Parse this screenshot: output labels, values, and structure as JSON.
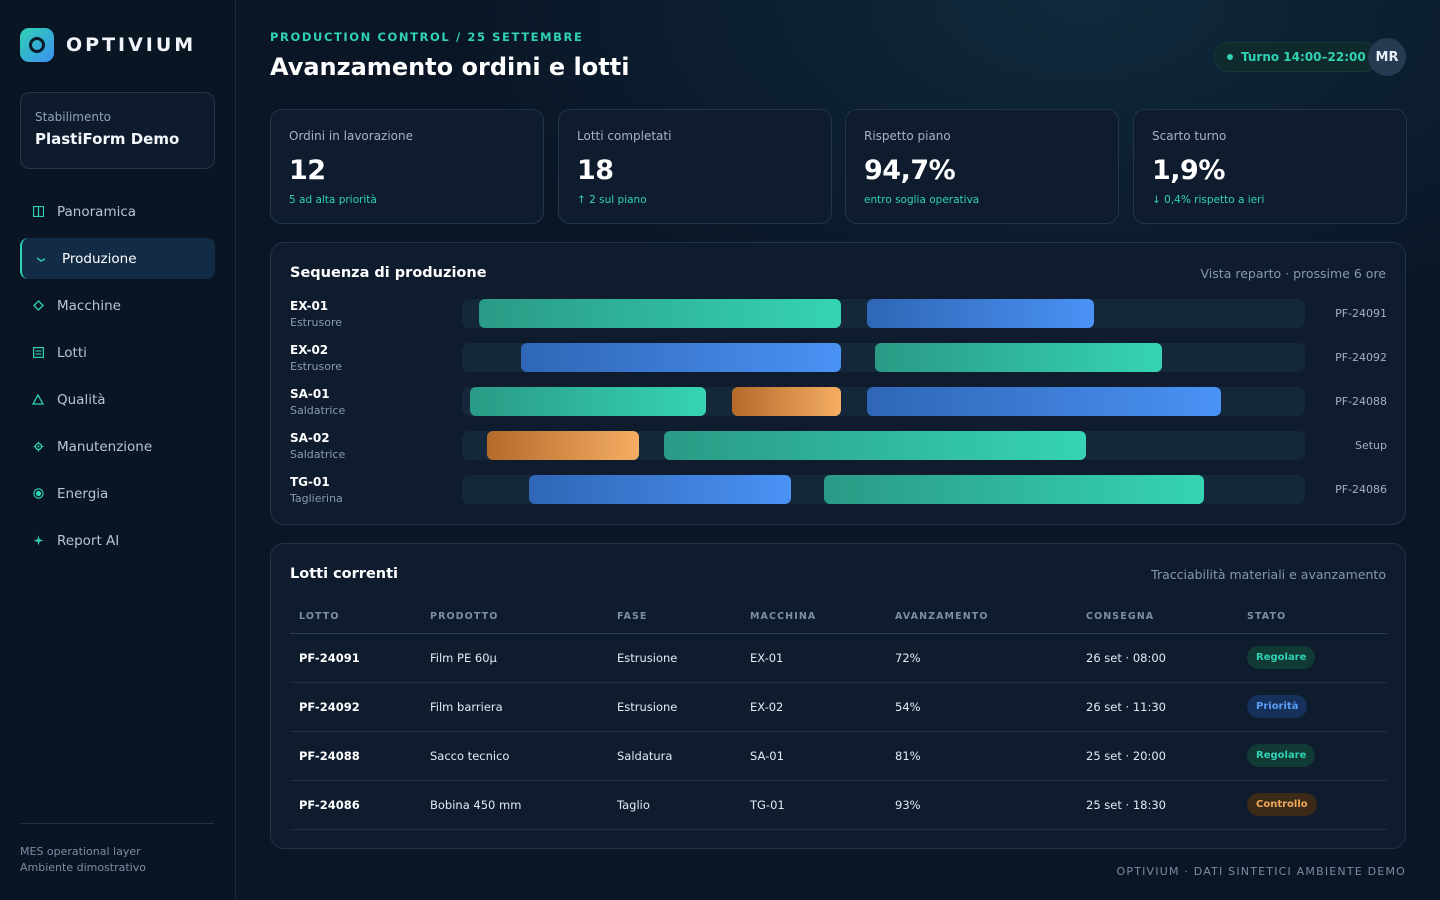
{
  "brand": {
    "name": "OPTIVIUM"
  },
  "plant": {
    "label": "Stabilimento",
    "name": "PlastiForm Demo"
  },
  "nav": [
    {
      "label": "Panoramica",
      "icon": "layout-icon",
      "active": false
    },
    {
      "label": "Produzione",
      "icon": "trend-icon",
      "active": true
    },
    {
      "label": "Macchine",
      "icon": "diamond-icon",
      "active": false
    },
    {
      "label": "Lotti",
      "icon": "list-icon",
      "active": false
    },
    {
      "label": "Qualità",
      "icon": "triangle-icon",
      "active": false
    },
    {
      "label": "Manutenzione",
      "icon": "gear-icon",
      "active": false
    },
    {
      "label": "Energia",
      "icon": "target-icon",
      "active": false
    },
    {
      "label": "Report AI",
      "icon": "sparkle-icon",
      "active": false
    }
  ],
  "sidebar_footer": {
    "line1": "MES operational layer",
    "line2": "Ambiente dimostrativo"
  },
  "header": {
    "breadcrumb": "PRODUCTION CONTROL / 25 SETTEMBRE",
    "title": "Avanzamento ordini e lotti",
    "shift": "Turno 14:00–22:00",
    "avatar": "MR"
  },
  "kpis": [
    {
      "label": "Ordini in lavorazione",
      "value": "12",
      "note": "5 ad alta priorità"
    },
    {
      "label": "Lotti completati",
      "value": "18",
      "note": "↑ 2 sul piano"
    },
    {
      "label": "Rispetto piano",
      "value": "94,7%",
      "note": "entro soglia operativa"
    },
    {
      "label": "Scarto turno",
      "value": "1,9%",
      "note": "↓ 0,4% rispetto a ieri"
    }
  ],
  "schedule": {
    "title": "Sequenza di produzione",
    "subtitle": "Vista reparto · prossime 6 ore",
    "rows": [
      {
        "machine": "EX-01",
        "type": "Estrusore",
        "ref": "PF-24091",
        "bars": [
          {
            "start": 0.02,
            "end": 0.45,
            "kind": "teal"
          },
          {
            "start": 0.48,
            "end": 0.75,
            "kind": "blue"
          }
        ]
      },
      {
        "machine": "EX-02",
        "type": "Estrusore",
        "ref": "PF-24092",
        "bars": [
          {
            "start": 0.07,
            "end": 0.45,
            "kind": "blue"
          },
          {
            "start": 0.49,
            "end": 0.83,
            "kind": "teal"
          }
        ]
      },
      {
        "machine": "SA-01",
        "type": "Saldatrice",
        "ref": "PF-24088",
        "bars": [
          {
            "start": 0.01,
            "end": 0.29,
            "kind": "teal"
          },
          {
            "start": 0.32,
            "end": 0.45,
            "kind": "orange"
          },
          {
            "start": 0.48,
            "end": 0.9,
            "kind": "blue"
          }
        ]
      },
      {
        "machine": "SA-02",
        "type": "Saldatrice",
        "ref": "Setup",
        "bars": [
          {
            "start": 0.03,
            "end": 0.21,
            "kind": "orange"
          },
          {
            "start": 0.24,
            "end": 0.74,
            "kind": "teal"
          }
        ]
      },
      {
        "machine": "TG-01",
        "type": "Taglierina",
        "ref": "PF-24086",
        "bars": [
          {
            "start": 0.08,
            "end": 0.39,
            "kind": "blue"
          },
          {
            "start": 0.43,
            "end": 0.88,
            "kind": "teal"
          }
        ]
      }
    ]
  },
  "lots": {
    "title": "Lotti correnti",
    "subtitle": "Tracciabilità materiali e avanzamento",
    "columns": [
      "LOTTO",
      "PRODOTTO",
      "FASE",
      "MACCHINA",
      "AVANZAMENTO",
      "CONSEGNA",
      "STATO"
    ],
    "rows": [
      {
        "lot": "PF-24091",
        "product": "Film PE 60µ",
        "phase": "Estrusione",
        "machine": "EX-01",
        "progress": "72%",
        "delivery": "26 set · 08:00",
        "status": "Regolare",
        "status_kind": "ok"
      },
      {
        "lot": "PF-24092",
        "product": "Film barriera",
        "phase": "Estrusione",
        "machine": "EX-02",
        "progress": "54%",
        "delivery": "26 set · 11:30",
        "status": "Priorità",
        "status_kind": "prio"
      },
      {
        "lot": "PF-24088",
        "product": "Sacco tecnico",
        "phase": "Saldatura",
        "machine": "SA-01",
        "progress": "81%",
        "delivery": "25 set · 20:00",
        "status": "Regolare",
        "status_kind": "ok"
      },
      {
        "lot": "PF-24086",
        "product": "Bobina 450 mm",
        "phase": "Taglio",
        "machine": "TG-01",
        "progress": "93%",
        "delivery": "25 set · 18:30",
        "status": "Controllo",
        "status_kind": "check"
      }
    ]
  },
  "footer": "OPTIVIUM · DATI SINTETICI AMBIENTE DEMO",
  "colors": {
    "accent": "#2fd2b4",
    "blue": "#4a92f5",
    "orange": "#f5ae63",
    "background": "#0a1626"
  }
}
